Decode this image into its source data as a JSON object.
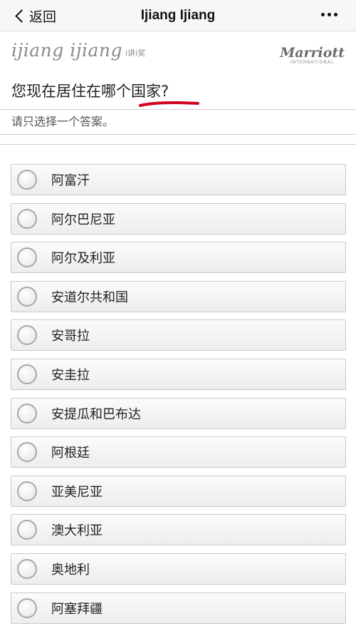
{
  "nav": {
    "back_label": "返回",
    "title": "Ijiang Ijiang"
  },
  "brand": {
    "left_logo": "ijiang ijiang",
    "left_sub": "i讲i奖",
    "right_logo": "Marriott",
    "right_sub": "INTERNATIONAL"
  },
  "survey": {
    "question": "您现在居住在哪个国家?",
    "instruction": "请只选择一个答案。",
    "underline_color": "#d0021b",
    "options": [
      {
        "label": "阿富汗"
      },
      {
        "label": "阿尔巴尼亚"
      },
      {
        "label": "阿尔及利亚"
      },
      {
        "label": "安道尔共和国"
      },
      {
        "label": "安哥拉"
      },
      {
        "label": "安圭拉"
      },
      {
        "label": "安提瓜和巴布达"
      },
      {
        "label": "阿根廷"
      },
      {
        "label": "亚美尼亚"
      },
      {
        "label": "澳大利亚"
      },
      {
        "label": "奥地利"
      },
      {
        "label": "阿塞拜疆"
      }
    ]
  }
}
